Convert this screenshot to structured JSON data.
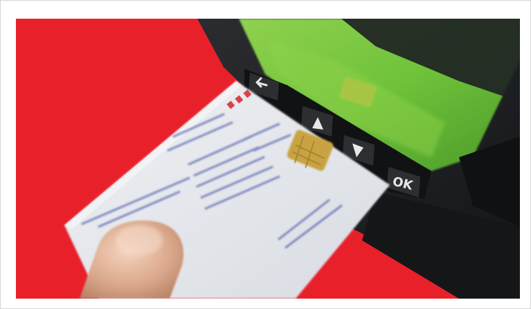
{
  "photo": {
    "background_color": "#e8202a",
    "device_color": "#1f2124",
    "display_color": "#6fc23a",
    "card_color": "#e6e8ec",
    "chip_color": "#c9a343",
    "card_text_color": "#2b3a9a",
    "card_brand_color": "#d7262a"
  },
  "buttons": {
    "back_icon": "return-arrow-icon",
    "up_icon": "triangle-up-icon",
    "down_icon": "triangle-down-icon",
    "ok_label": "OK"
  }
}
